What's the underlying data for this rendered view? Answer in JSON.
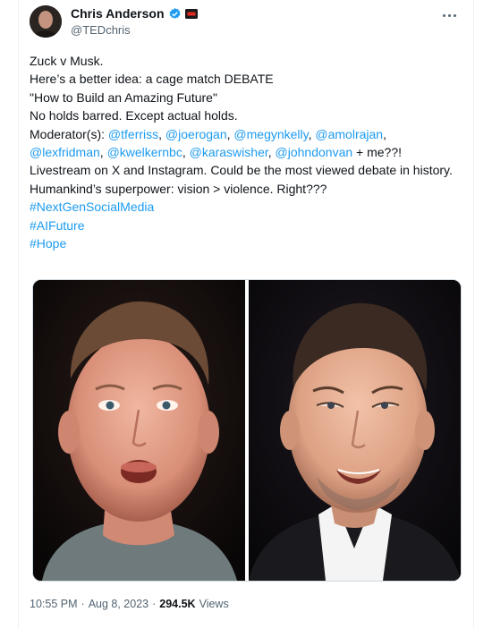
{
  "author": {
    "display_name": "Chris Anderson",
    "handle": "@TEDchris",
    "verified_icon": "verified-badge-icon",
    "affiliation_icon": "ted-affiliation-icon"
  },
  "tweet": {
    "lines": {
      "l1": "Zuck v Musk.",
      "l2": "Here’s a better idea: a cage match DEBATE",
      "l3": "\"How to Build an Amazing Future\"",
      "l4": "No holds barred. Except actual holds.",
      "l5_prefix": "Moderator(s): ",
      "m1": "@tferriss",
      "m2": "@joerogan",
      "m3": "@megynkelly",
      "m4": "@amolrajan",
      "m5": "@lexfridman",
      "m6": "@kwelkernbc",
      "m7": "@karaswisher",
      "m8": "@johndonvan",
      "sep": ", ",
      "tail": " + me??!",
      "l7": "Livestream on X and Instagram. Could be the most viewed debate in history.",
      "l8": "Humankind’s superpower: vision > violence. Right???"
    },
    "hashtags": [
      "#NextGenSocialMedia",
      "#AIFuture",
      "#Hope"
    ]
  },
  "media": {
    "left_photo": "mark-zuckerberg-photo",
    "right_photo": "elon-musk-photo"
  },
  "meta": {
    "time": "10:55 PM",
    "dot": "·",
    "date": "Aug 8, 2023",
    "views_count": "294.5K",
    "views_label": "Views"
  },
  "colors": {
    "link": "#1d9bf0",
    "text": "#0f1419",
    "secondary": "#536471"
  }
}
